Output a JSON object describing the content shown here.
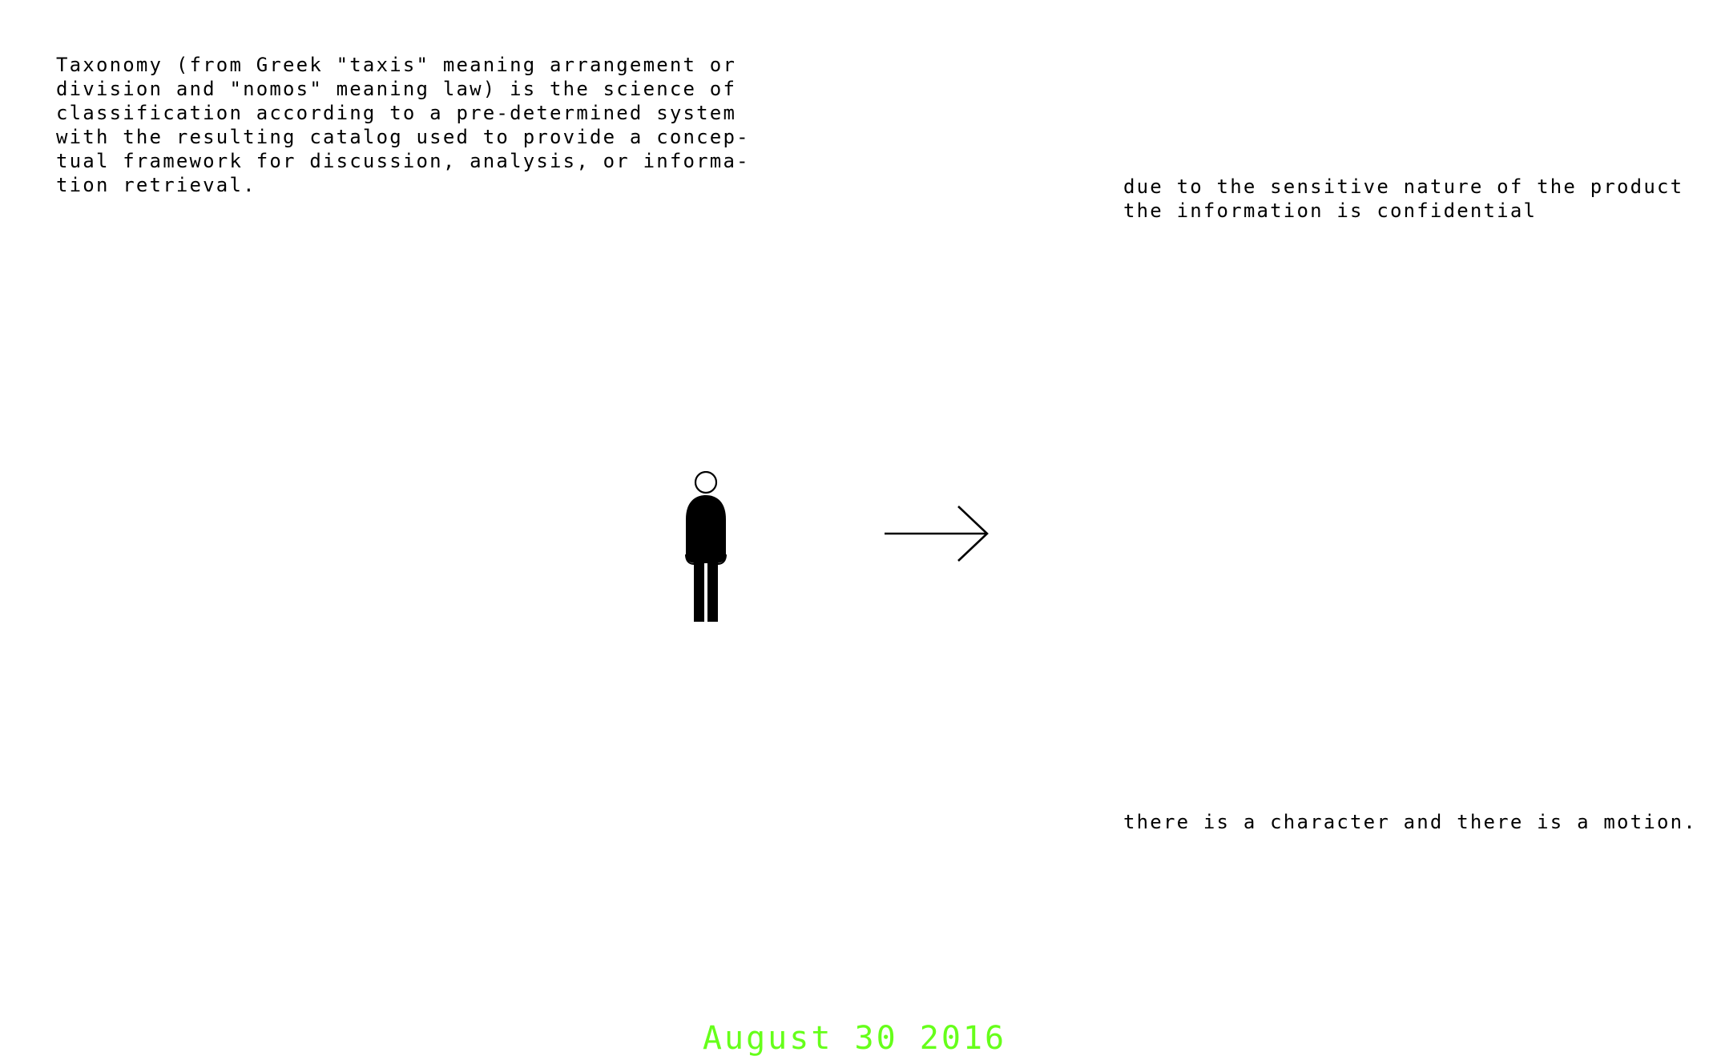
{
  "taxonomy_text": {
    "lines": [
      "Taxonomy (from Greek \"taxis\" meaning arrangement or",
      "division and \"nomos\" meaning law) is the science of",
      "classification according to a pre-determined system",
      "with the resulting catalog used to provide a concep-",
      "tual framework for discussion, analysis, or informa-",
      "tion retrieval."
    ]
  },
  "confidential_text": {
    "lines": [
      "due to the sensitive nature of the product",
      "the information is confidential"
    ]
  },
  "motion_text": {
    "line": "there is a character and there is a motion."
  },
  "date": {
    "text": "August 30 2016",
    "color": "#66ff1a"
  },
  "icons": {
    "figure": "person-icon",
    "arrow": "arrow-right-icon"
  },
  "colors": {
    "background": "#ffffff",
    "text": "#000000"
  }
}
